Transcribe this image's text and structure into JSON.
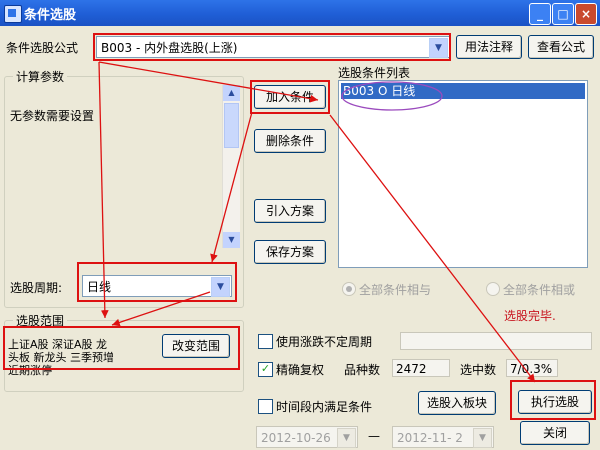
{
  "window": {
    "title": "条件选股",
    "min": "_",
    "max": "□",
    "close": "×"
  },
  "formula": {
    "label": "条件选股公式",
    "value": "B003     - 内外盘选股(上涨)",
    "usage_btn": "用法注释",
    "view_btn": "查看公式"
  },
  "params": {
    "legend": "计算参数",
    "note": "无参数需要设置"
  },
  "period": {
    "label": "选股周期:",
    "value": "日线"
  },
  "range": {
    "legend": "选股范围",
    "text_line1": "上证A股 深证A股 龙",
    "text_line2": "头板 新龙头 三季预增",
    "text_line3": "近期涨停",
    "change_btn": "改变范围"
  },
  "actions": {
    "add": "加入条件",
    "delete": "删除条件",
    "import": "引入方案",
    "save": "保存方案"
  },
  "conditions": {
    "label": "选股条件列表",
    "items": [
      "B003  O  日线"
    ]
  },
  "logic": {
    "all_and": "全部条件相与",
    "all_or": "全部条件相或"
  },
  "status": {
    "done": "选股完毕."
  },
  "options": {
    "unstable": "使用涨跌不定周期",
    "precise": "精确复权",
    "count_label": "品种数",
    "count_value": "2472",
    "selected_label": "选中数",
    "selected_value": "7/0.3%",
    "timerange": "时间段内满足条件"
  },
  "buttons": {
    "to_block": "选股入板块",
    "execute": "执行选股",
    "close": "关闭"
  },
  "dates": {
    "start": "2012-10-26",
    "sep": "—",
    "end": "2012-11- 2"
  },
  "colors": {
    "highlight": "#DD1111",
    "selection": "#316AC5",
    "titlebar": "#1F5ED6"
  }
}
